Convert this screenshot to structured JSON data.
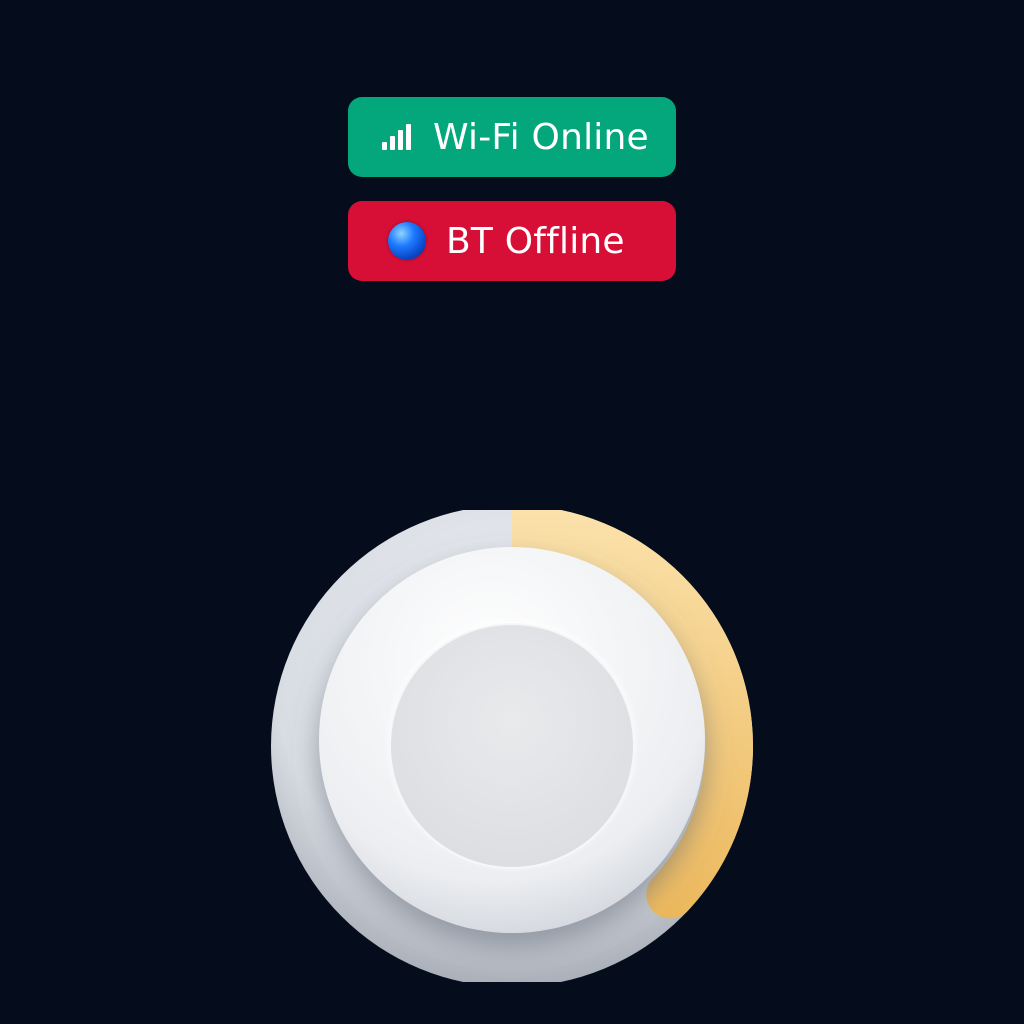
{
  "status": {
    "wifi": {
      "label": "Wi-Fi Online",
      "icon": "signal-bars-icon",
      "color": "#04a77c"
    },
    "bluetooth": {
      "label": "BT Offline",
      "icon": "blue-orb-icon",
      "color": "#d70f36"
    }
  },
  "knob": {
    "level": 0.37,
    "accent_color": "#f2c56c",
    "track_color": "#d4d8df"
  }
}
